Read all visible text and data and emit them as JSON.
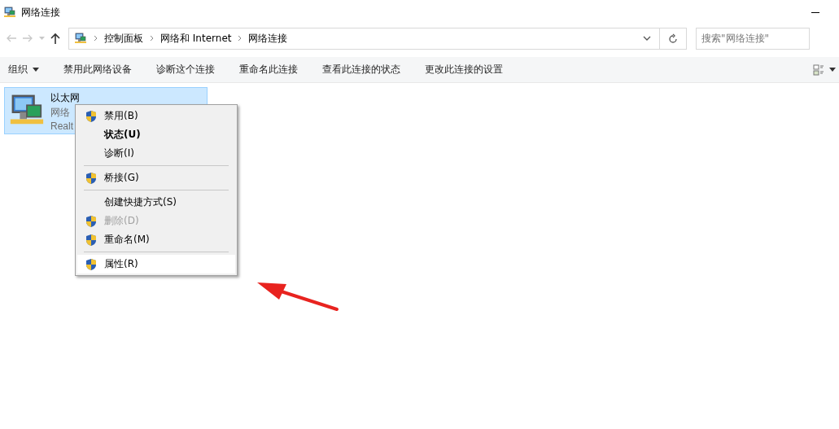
{
  "window": {
    "title": "网络连接"
  },
  "navigation": {
    "back": {
      "disabled": true
    },
    "forward": {
      "disabled": true
    },
    "up": {
      "disabled": false
    }
  },
  "address_bar": {
    "breadcrumbs": [
      "控制面板",
      "网络和 Internet",
      "网络连接"
    ]
  },
  "search": {
    "placeholder": "搜索\"网络连接\""
  },
  "toolbar": {
    "items": [
      {
        "label": "组织",
        "dropdown": true
      },
      {
        "label": "禁用此网络设备",
        "dropdown": false
      },
      {
        "label": "诊断这个连接",
        "dropdown": false
      },
      {
        "label": "重命名此连接",
        "dropdown": false
      },
      {
        "label": "查看此连接的状态",
        "dropdown": false
      },
      {
        "label": "更改此连接的设置",
        "dropdown": false
      }
    ]
  },
  "connections": [
    {
      "name": "以太网",
      "status": "网络",
      "device": "Realt",
      "selected": true
    }
  ],
  "context_menu": {
    "items": [
      {
        "kind": "item",
        "label": "禁用(B)",
        "shield": true,
        "bold": false,
        "disabled": false,
        "selected": false
      },
      {
        "kind": "item",
        "label": "状态(U)",
        "shield": false,
        "bold": true,
        "disabled": false,
        "selected": false
      },
      {
        "kind": "item",
        "label": "诊断(I)",
        "shield": false,
        "bold": false,
        "disabled": false,
        "selected": false
      },
      {
        "kind": "separator"
      },
      {
        "kind": "item",
        "label": "桥接(G)",
        "shield": true,
        "bold": false,
        "disabled": false,
        "selected": false
      },
      {
        "kind": "separator"
      },
      {
        "kind": "item",
        "label": "创建快捷方式(S)",
        "shield": false,
        "bold": false,
        "disabled": false,
        "selected": false
      },
      {
        "kind": "item",
        "label": "删除(D)",
        "shield": true,
        "bold": false,
        "disabled": true,
        "selected": false
      },
      {
        "kind": "item",
        "label": "重命名(M)",
        "shield": true,
        "bold": false,
        "disabled": false,
        "selected": false
      },
      {
        "kind": "separator"
      },
      {
        "kind": "item",
        "label": "属性(R)",
        "shield": true,
        "bold": false,
        "disabled": false,
        "selected": true
      }
    ]
  }
}
